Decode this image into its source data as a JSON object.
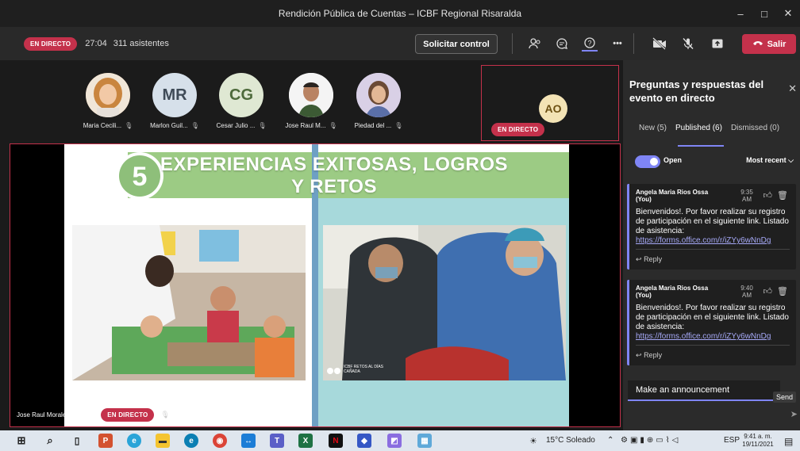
{
  "window": {
    "title": "Rendición Pública de Cuentas – ICBF Regional Risaralda",
    "min": "–",
    "max": "□",
    "close": "✕"
  },
  "toolbar": {
    "live_label": "EN DIRECTO",
    "elapsed": "27:04",
    "attendees": "311 asistentes",
    "request_control": "Solicitar control",
    "more": "•••",
    "leave": "Salir"
  },
  "participants": [
    {
      "name": "Maria Cecili...",
      "initials": "",
      "avatar_color": "#d9a26b"
    },
    {
      "name": "Marlon Guil...",
      "initials": "MR",
      "avatar_color": "#d6e0ea"
    },
    {
      "name": "Cesar Julio ...",
      "initials": "CG",
      "avatar_color": "#dfe8d3"
    },
    {
      "name": "Jose Raul M...",
      "initials": "",
      "avatar_color": "#efefef"
    },
    {
      "name": "Piedad del ...",
      "initials": "",
      "avatar_color": "#c9b8d9"
    }
  ],
  "featured": {
    "initials": "AO",
    "live_label": "EN DIRECTO"
  },
  "main_video": {
    "slide_number": "5",
    "slide_title": "EXPERIENCIAS EXITOSAS, LOGROS Y RETOS",
    "photo_caption": "ICBF RETOS AL DÍAS CAÑADA",
    "speaker": "Jose Raul Morales Ramirez",
    "live_label": "EN DIRECTO"
  },
  "qa_panel": {
    "title": "Preguntas y respuestas del evento en directo",
    "tabs": [
      "New (5)",
      "Published (6)",
      "Dismissed (0)"
    ],
    "active_tab": "Published (6)",
    "toggle_label": "Open",
    "sort": "Most recent",
    "questions": [
      {
        "author": "Angela Maria Rios Ossa (You)",
        "time": "9:35 AM",
        "body": "Bienvenidos!. Por favor realizar su registro de participación en el siguiente link. Listado de asistencia:",
        "link": "https://forms.office.com/r/iZYy6wNnDg",
        "reply": "Reply"
      },
      {
        "author": "Angela Maria Rios Ossa (You)",
        "time": "9:40 AM",
        "body": "Bienvenidos!. Por favor realizar su registro de participación en el siguiente link. Listado de asistencia:",
        "link": "https://forms.office.com/r/iZYy6wNnDg",
        "reply": "Reply"
      }
    ],
    "announce_placeholder": "Make an announcement",
    "send": "Send"
  },
  "taskbar": {
    "weather": "15°C Soleado",
    "lang": "ESP",
    "time": "9:41 a. m.",
    "date": "19/11/2021"
  },
  "colors": {
    "live_red": "#c4314b",
    "accent": "#7f85f5",
    "slide_green": "#8ebf7a",
    "slide_teal": "#82cfd4"
  }
}
